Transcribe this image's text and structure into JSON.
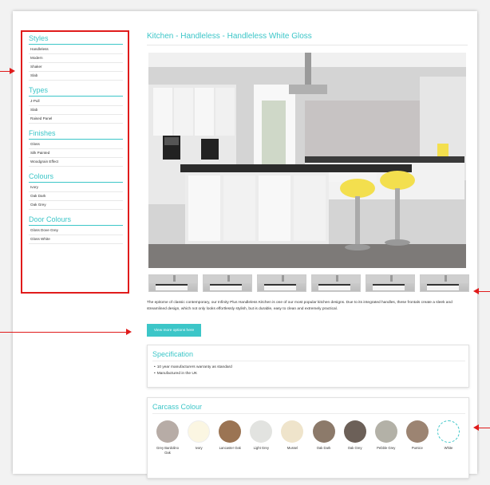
{
  "sidebar": {
    "sections": [
      {
        "heading": "Styles",
        "items": [
          "Handleless",
          "Modern",
          "Shaker",
          "Slab"
        ]
      },
      {
        "heading": "Types",
        "items": [
          "J-Pull",
          "Slab",
          "Raised Panel"
        ]
      },
      {
        "heading": "Finishes",
        "items": [
          "Gloss",
          "Silk Painted",
          "Woodgrain Effect"
        ]
      },
      {
        "heading": "Colours",
        "items": [
          "Ivory",
          "Oak Dark",
          "Oak Grey"
        ]
      },
      {
        "heading": "Door Colours",
        "items": [
          "Gloss Dove Grey",
          "Gloss White"
        ]
      }
    ]
  },
  "product": {
    "title": "Kitchen - Handleless - Handleless White Gloss",
    "description": "The epitome of classic contemporary, our Infinity Plus Handleless Kitchen is one of our most popular kitchen designs. Due to its integrated handles, these frontals create a sleek and streamlined design, which not only looks effortlessly stylish, but is durable, easy to clean and extremely practical.",
    "more_button": "View more options here"
  },
  "specification": {
    "heading": "Specification",
    "items": [
      "10 year manufacturers warranty as standard",
      "Manufactured in the UK"
    ]
  },
  "carcass": {
    "heading": "Carcass Colour",
    "swatches": [
      {
        "label": "Grey Bardolino Oak",
        "color": "#b7aca6"
      },
      {
        "label": "Ivory",
        "color": "#fbf6e2"
      },
      {
        "label": "Lancaster Oak",
        "color": "#9b7453"
      },
      {
        "label": "Light Grey",
        "color": "#e2e3e0"
      },
      {
        "label": "Mussel",
        "color": "#efe4cb"
      },
      {
        "label": "Oak Dark",
        "color": "#8c7a6a"
      },
      {
        "label": "Oak Grey",
        "color": "#6c6058"
      },
      {
        "label": "Pebble Grey",
        "color": "#b3b1a7"
      },
      {
        "label": "Pumice",
        "color": "#9c8472"
      },
      {
        "label": "White",
        "color": "#ffffff"
      }
    ]
  },
  "colors": {
    "accent": "#3cc6c8",
    "annotation": "#e01b1b"
  }
}
